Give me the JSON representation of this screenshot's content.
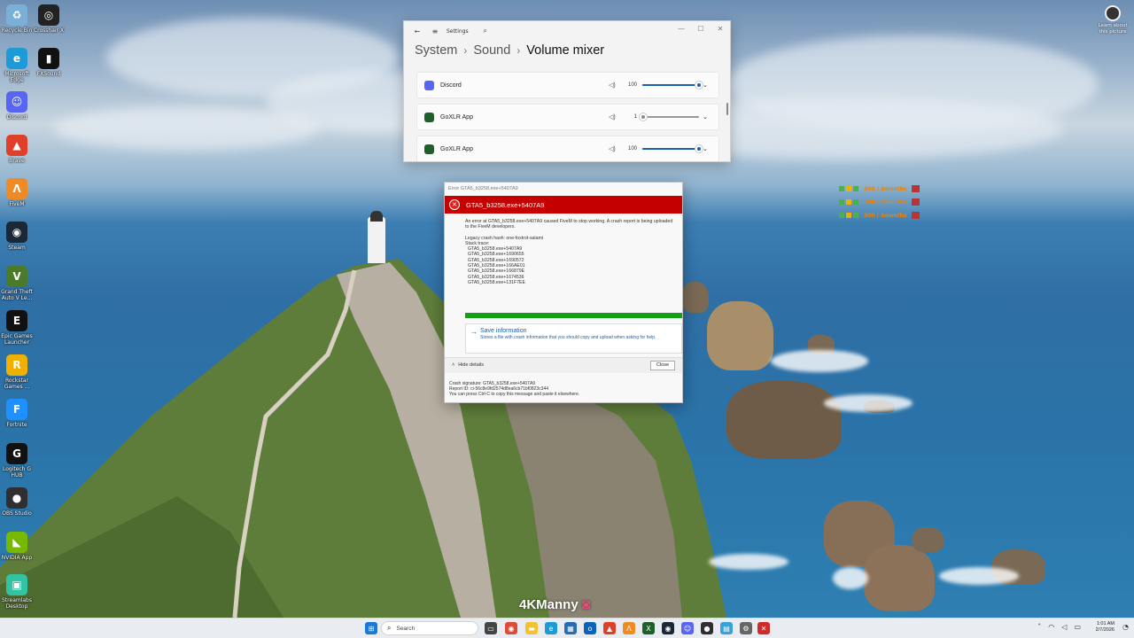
{
  "desktop": {
    "icons": [
      {
        "label": "Recycle Bin",
        "color": "#7ab0d8",
        "glyph": "♻"
      },
      {
        "label": "Crosshair X",
        "color": "#222222",
        "glyph": "◎"
      },
      {
        "label": "Microsoft Edge",
        "color": "#1d9bd6",
        "glyph": "e"
      },
      {
        "label": "FXSound",
        "color": "#111111",
        "glyph": "▮"
      },
      {
        "label": "Discord",
        "color": "#5865f2",
        "glyph": "☺"
      },
      {
        "label": "Brave",
        "color": "#e0402a",
        "glyph": "▲"
      },
      {
        "label": "FiveM",
        "color": "#f08a24",
        "glyph": "Λ"
      },
      {
        "label": "Steam",
        "color": "#1b2838",
        "glyph": "◉"
      },
      {
        "label": "Grand Theft Auto V Le...",
        "color": "#4a7a2a",
        "glyph": "V"
      },
      {
        "label": "Epic Games Launcher",
        "color": "#111111",
        "glyph": "E"
      },
      {
        "label": "Rockstar Games ...",
        "color": "#f0b000",
        "glyph": "R"
      },
      {
        "label": "Fortnite",
        "color": "#1e90ff",
        "glyph": "F"
      },
      {
        "label": "Logitech G HUB",
        "color": "#111111",
        "glyph": "G"
      },
      {
        "label": "OBS Studio",
        "color": "#302e31",
        "glyph": "●"
      },
      {
        "label": "NVIDIA App",
        "color": "#76b900",
        "glyph": "◣"
      },
      {
        "label": "Streamlabs Desktop",
        "color": "#31c3a2",
        "glyph": "▣"
      }
    ],
    "learn_label": "Learn about this picture",
    "watermark": "4KManny",
    "notification_tags": [
      {
        "text": "300 / 3months"
      },
      {
        "text": "300 / 3months"
      },
      {
        "text": "300 / 3months"
      }
    ]
  },
  "settings": {
    "window_title": "Settings",
    "breadcrumb": {
      "part1": "System",
      "part2": "Sound",
      "current": "Volume mixer"
    },
    "rows": [
      {
        "app": "Discord",
        "icon_color": "#5865f2",
        "volume": "100",
        "level": 1.0
      },
      {
        "app": "GoXLR App",
        "icon_color": "#1f5f2a",
        "volume": "1",
        "level": 0.01
      },
      {
        "app": "GoXLR App",
        "icon_color": "#1f5f2a",
        "volume": "100",
        "level": 1.0
      }
    ]
  },
  "error_dialog": {
    "window_title": "Error GTA5_b3258.exe+5407A9",
    "header": "GTA5_b3258.exe+5407A9",
    "message": "An error at GTA5_b3258.exe+5407A9 caused FiveM to stop working. A crash report is being uploaded to the FiveM developers.",
    "legacy_hash": "Legacy crash hash: one-foxtrot-salami",
    "stack_label": "Stack trace:",
    "stack": [
      "GTA5_b3258.exe+5407A9",
      "GTA5_b3258.exe+1690655",
      "GTA5_b3258.exe+1690572",
      "GTA5_b3258.exe+166AE01",
      "GTA5_b3258.exe+166879E",
      "GTA5_b3258.exe+1674536",
      "GTA5_b3258.exe+131F7EE"
    ],
    "progress": 1.0,
    "save_title": "Save information",
    "save_desc": "Stores a file with crash information that you should copy and upload when asking for help.",
    "hide_details": "Hide details",
    "close": "Close",
    "crash_signature": "Crash signature: GTA5_b3258.exe+5407A9",
    "report_id": "Report ID: ci-56c8e9fd2574d8ea6cb71bf0823c344",
    "copy_hint": "You can press Ctrl-C to copy this message and paste it elsewhere."
  },
  "taskbar": {
    "search_placeholder": "Search",
    "time": "1:01 AM",
    "date": "2/7/2026"
  }
}
